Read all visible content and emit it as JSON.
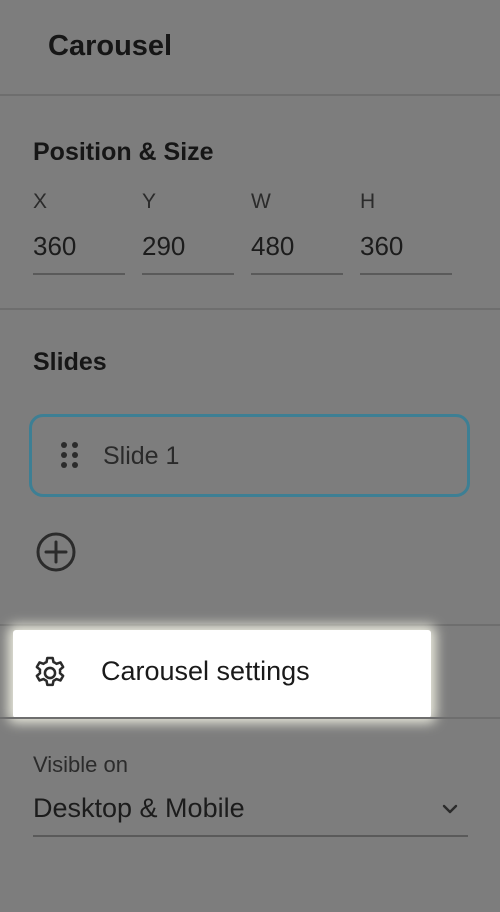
{
  "header": {
    "title": "Carousel"
  },
  "position_size": {
    "title": "Position & Size",
    "fields": [
      {
        "label": "X",
        "value": "360"
      },
      {
        "label": "Y",
        "value": "290"
      },
      {
        "label": "W",
        "value": "480"
      },
      {
        "label": "H",
        "value": "360"
      }
    ]
  },
  "slides": {
    "title": "Slides",
    "items": [
      {
        "label": "Slide 1",
        "selected": true
      }
    ],
    "add_icon": "plus-circle-icon"
  },
  "settings": {
    "label": "Carousel settings",
    "icon": "gear-icon"
  },
  "visibility": {
    "label": "Visible on",
    "value": "Desktop & Mobile",
    "icon": "chevron-down-icon"
  },
  "colors": {
    "backdrop": "#7d7d7d",
    "highlight": "#ffffff",
    "selected_border": "#3d7f94"
  }
}
